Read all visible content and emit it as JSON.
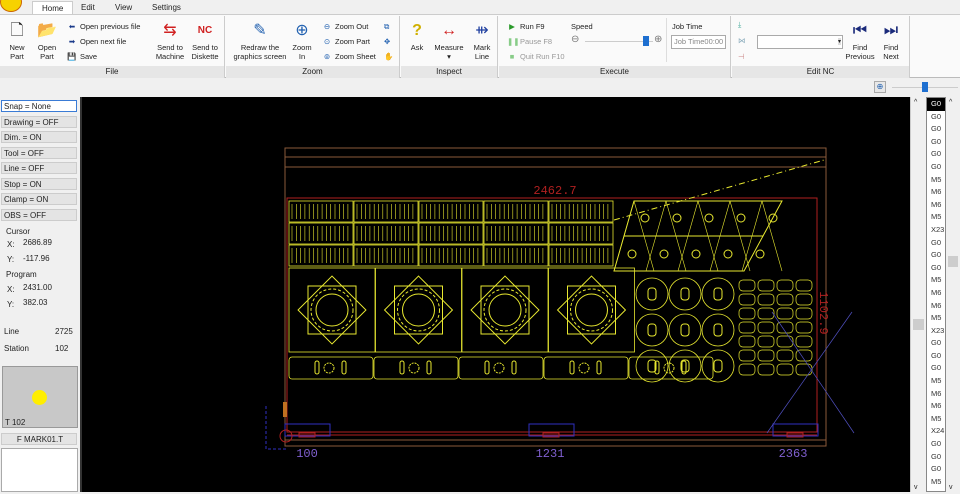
{
  "tabs": [
    "Home",
    "Edit",
    "View",
    "Settings"
  ],
  "ribbon": {
    "file": {
      "label": "File",
      "new_part": "New\nPart",
      "open_part": "Open\nPart",
      "open_previous": "Open previous file",
      "open_next": "Open next file",
      "save": "Save",
      "send_machine": "Send to\nMachine",
      "send_diskette": "Send to\nDiskette"
    },
    "zoom": {
      "label": "Zoom",
      "redraw": "Redraw the\ngraphics screen",
      "zoom_in": "Zoom\nIn",
      "zoom_out": "Zoom Out",
      "zoom_part": "Zoom Part",
      "zoom_sheet": "Zoom Sheet"
    },
    "inspect": {
      "label": "Inspect",
      "ask": "Ask",
      "measure": "Measure",
      "mark_line": "Mark\nLine"
    },
    "execute": {
      "label": "Execute",
      "run": "Run F9",
      "pause": "Pause F8",
      "quit": "Quit Run F10",
      "speed": "Speed",
      "speed_value": 0.9,
      "job_time": "Job Time",
      "job_time_value": "Job Time00:00"
    },
    "edit_nc": {
      "label": "Edit NC",
      "dropdown_value": "",
      "find_previous": "Find\nPrevious",
      "find_next": "Find\nNext"
    }
  },
  "zoom_slider_value": 0.5,
  "left": {
    "toggles": [
      "Snap = None",
      "Drawing = OFF",
      "Dim. = ON",
      "Tool = OFF",
      "Line = OFF",
      "Stop = ON",
      "Clamp = ON",
      "OBS = OFF"
    ],
    "cursor": {
      "label": "Cursor",
      "x_label": "X:",
      "x": "2686.89",
      "y_label": "Y:",
      "y": "-117.96"
    },
    "program": {
      "label": "Program",
      "x_label": "X:",
      "x": "2431.00",
      "y_label": "Y:",
      "y": "382.03"
    },
    "line_label": "Line",
    "line": "2725",
    "station_label": "Station",
    "station": "102",
    "tool_label": "T 102",
    "file": "F MARK01.T"
  },
  "canvas": {
    "dim_width": "2462.7",
    "dim_height": "1102.9",
    "clamps": [
      "100",
      "1231",
      "2363"
    ],
    "colors": {
      "part": "#e8e830",
      "sheet": "#b02020",
      "clamp": "#3030c0",
      "label": "#8060d0"
    }
  },
  "nc_list": [
    "G0",
    "G0",
    "G0",
    "G0",
    "G0",
    "G0",
    "M5",
    "M6",
    "M6",
    "M5",
    "X23",
    "G0",
    "G0",
    "G0",
    "M5",
    "M6",
    "M6",
    "M5",
    "X23",
    "G0",
    "G0",
    "G0",
    "M5",
    "M6",
    "M6",
    "M5",
    "X24",
    "G0",
    "G0",
    "G0",
    "M5"
  ]
}
